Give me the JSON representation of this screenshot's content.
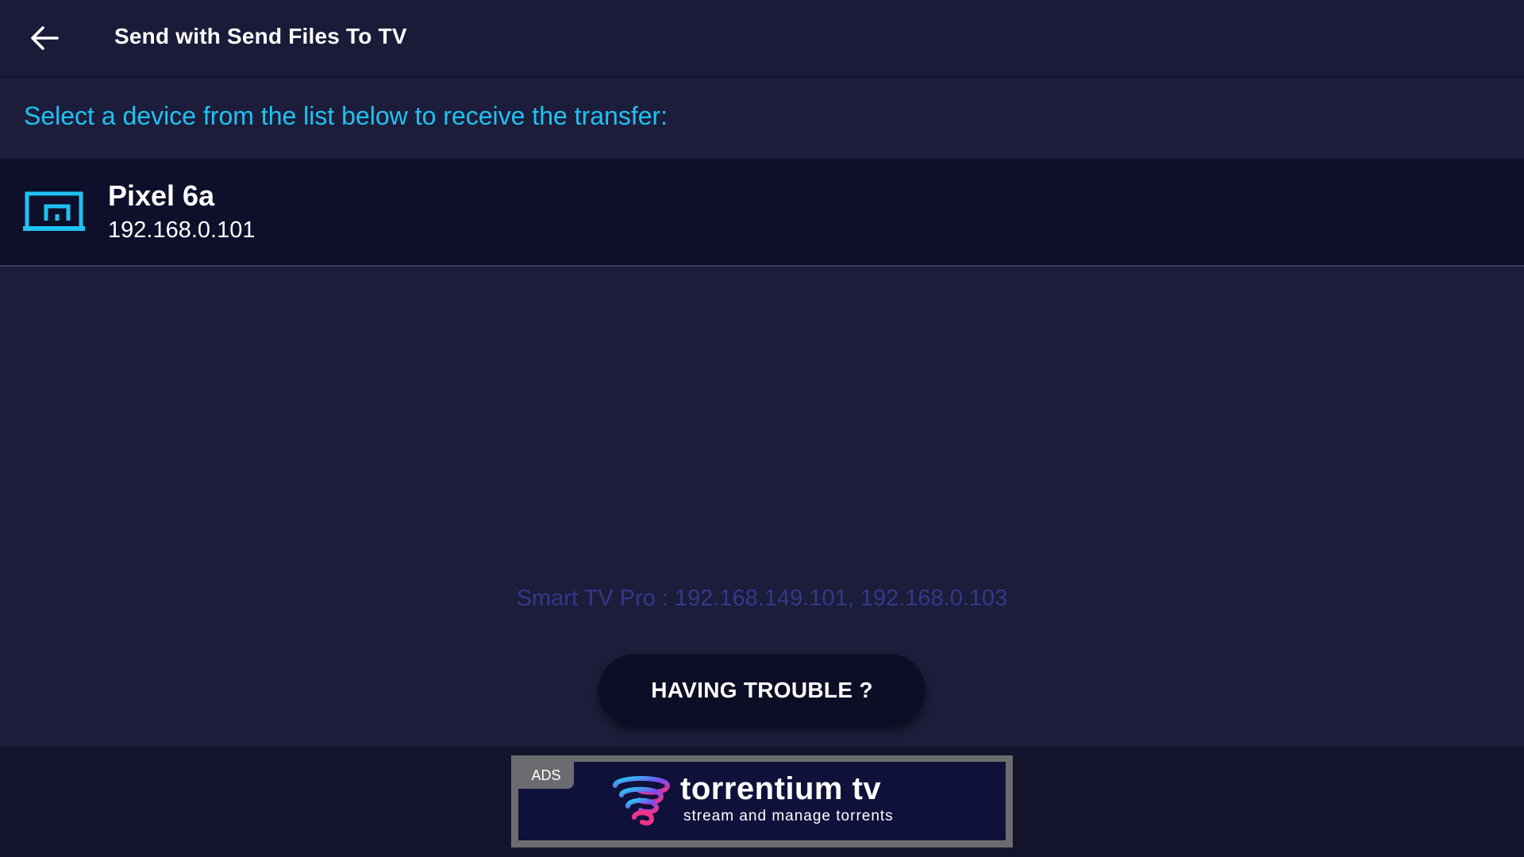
{
  "header": {
    "back_icon": "arrow-left-icon",
    "title": "Send with Send Files To TV"
  },
  "instruction": "Select a device from the list below to receive the transfer:",
  "devices": [
    {
      "icon": "cast-device-icon",
      "name": "Pixel 6a",
      "ip": "192.168.0.101"
    }
  ],
  "server_info": "Smart TV Pro : 192.168.149.101, 192.168.0.103",
  "trouble_button": "HAVING TROUBLE ?",
  "ad": {
    "badge": "ADS",
    "logo_icon": "torrentium-logo-icon",
    "brand": "torrentium tv",
    "tagline": "stream and manage torrents"
  },
  "colors": {
    "background": "#1b1d3b",
    "accent": "#1fc2f0",
    "device_row": "#0e0f2a",
    "server_info_text": "#34388a",
    "ad_border": "#6c6c70"
  }
}
